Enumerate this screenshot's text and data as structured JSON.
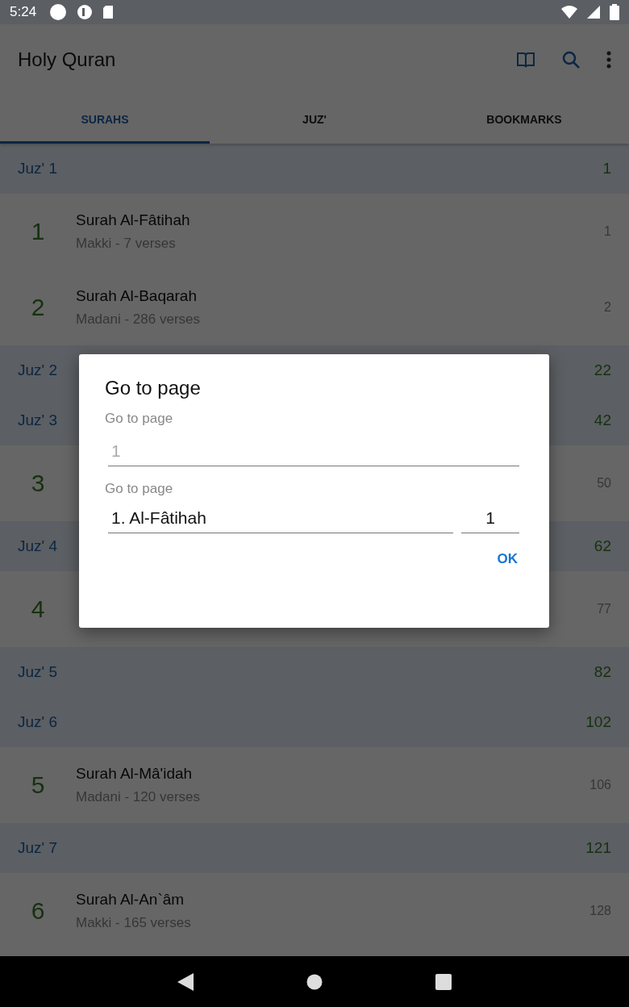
{
  "status_bar": {
    "time": "5:24"
  },
  "app_bar": {
    "title": "Holy Quran"
  },
  "tabs": [
    {
      "label": "SURAHS",
      "selected": true
    },
    {
      "label": "JUZ'",
      "selected": false
    },
    {
      "label": "BOOKMARKS",
      "selected": false
    }
  ],
  "list": [
    {
      "kind": "juz",
      "label": "Juz' 1",
      "page": "1"
    },
    {
      "kind": "surah",
      "number": "1",
      "title": "Surah Al-Fâtihah",
      "subtitle": "Makki - 7 verses",
      "page": "1"
    },
    {
      "kind": "surah",
      "number": "2",
      "title": "Surah Al-Baqarah",
      "subtitle": "Madani - 286 verses",
      "page": "2"
    },
    {
      "kind": "juz",
      "label": "Juz' 2",
      "page": "22"
    },
    {
      "kind": "juz",
      "label": "Juz' 3",
      "page": "42"
    },
    {
      "kind": "surah",
      "number": "3",
      "page": "50"
    },
    {
      "kind": "juz",
      "label": "Juz' 4",
      "page": "62"
    },
    {
      "kind": "surah",
      "number": "4",
      "page": "77"
    },
    {
      "kind": "juz",
      "label": "Juz' 5",
      "page": "82"
    },
    {
      "kind": "juz",
      "label": "Juz' 6",
      "page": "102"
    },
    {
      "kind": "surah",
      "number": "5",
      "title": "Surah Al-Mâ'idah",
      "subtitle": "Madani - 120 verses",
      "page": "106"
    },
    {
      "kind": "juz",
      "label": "Juz' 7",
      "page": "121"
    },
    {
      "kind": "surah",
      "number": "6",
      "title": "Surah Al-An`âm",
      "subtitle": "Makki - 165 verses",
      "page": "128"
    }
  ],
  "dialog": {
    "title": "Go to page",
    "page_label": "Go to page",
    "page_placeholder": "1",
    "surah_label": "Go to page",
    "surah_value": "1. Al-Fâtihah",
    "verse_value": "1",
    "ok_button": "OK"
  }
}
